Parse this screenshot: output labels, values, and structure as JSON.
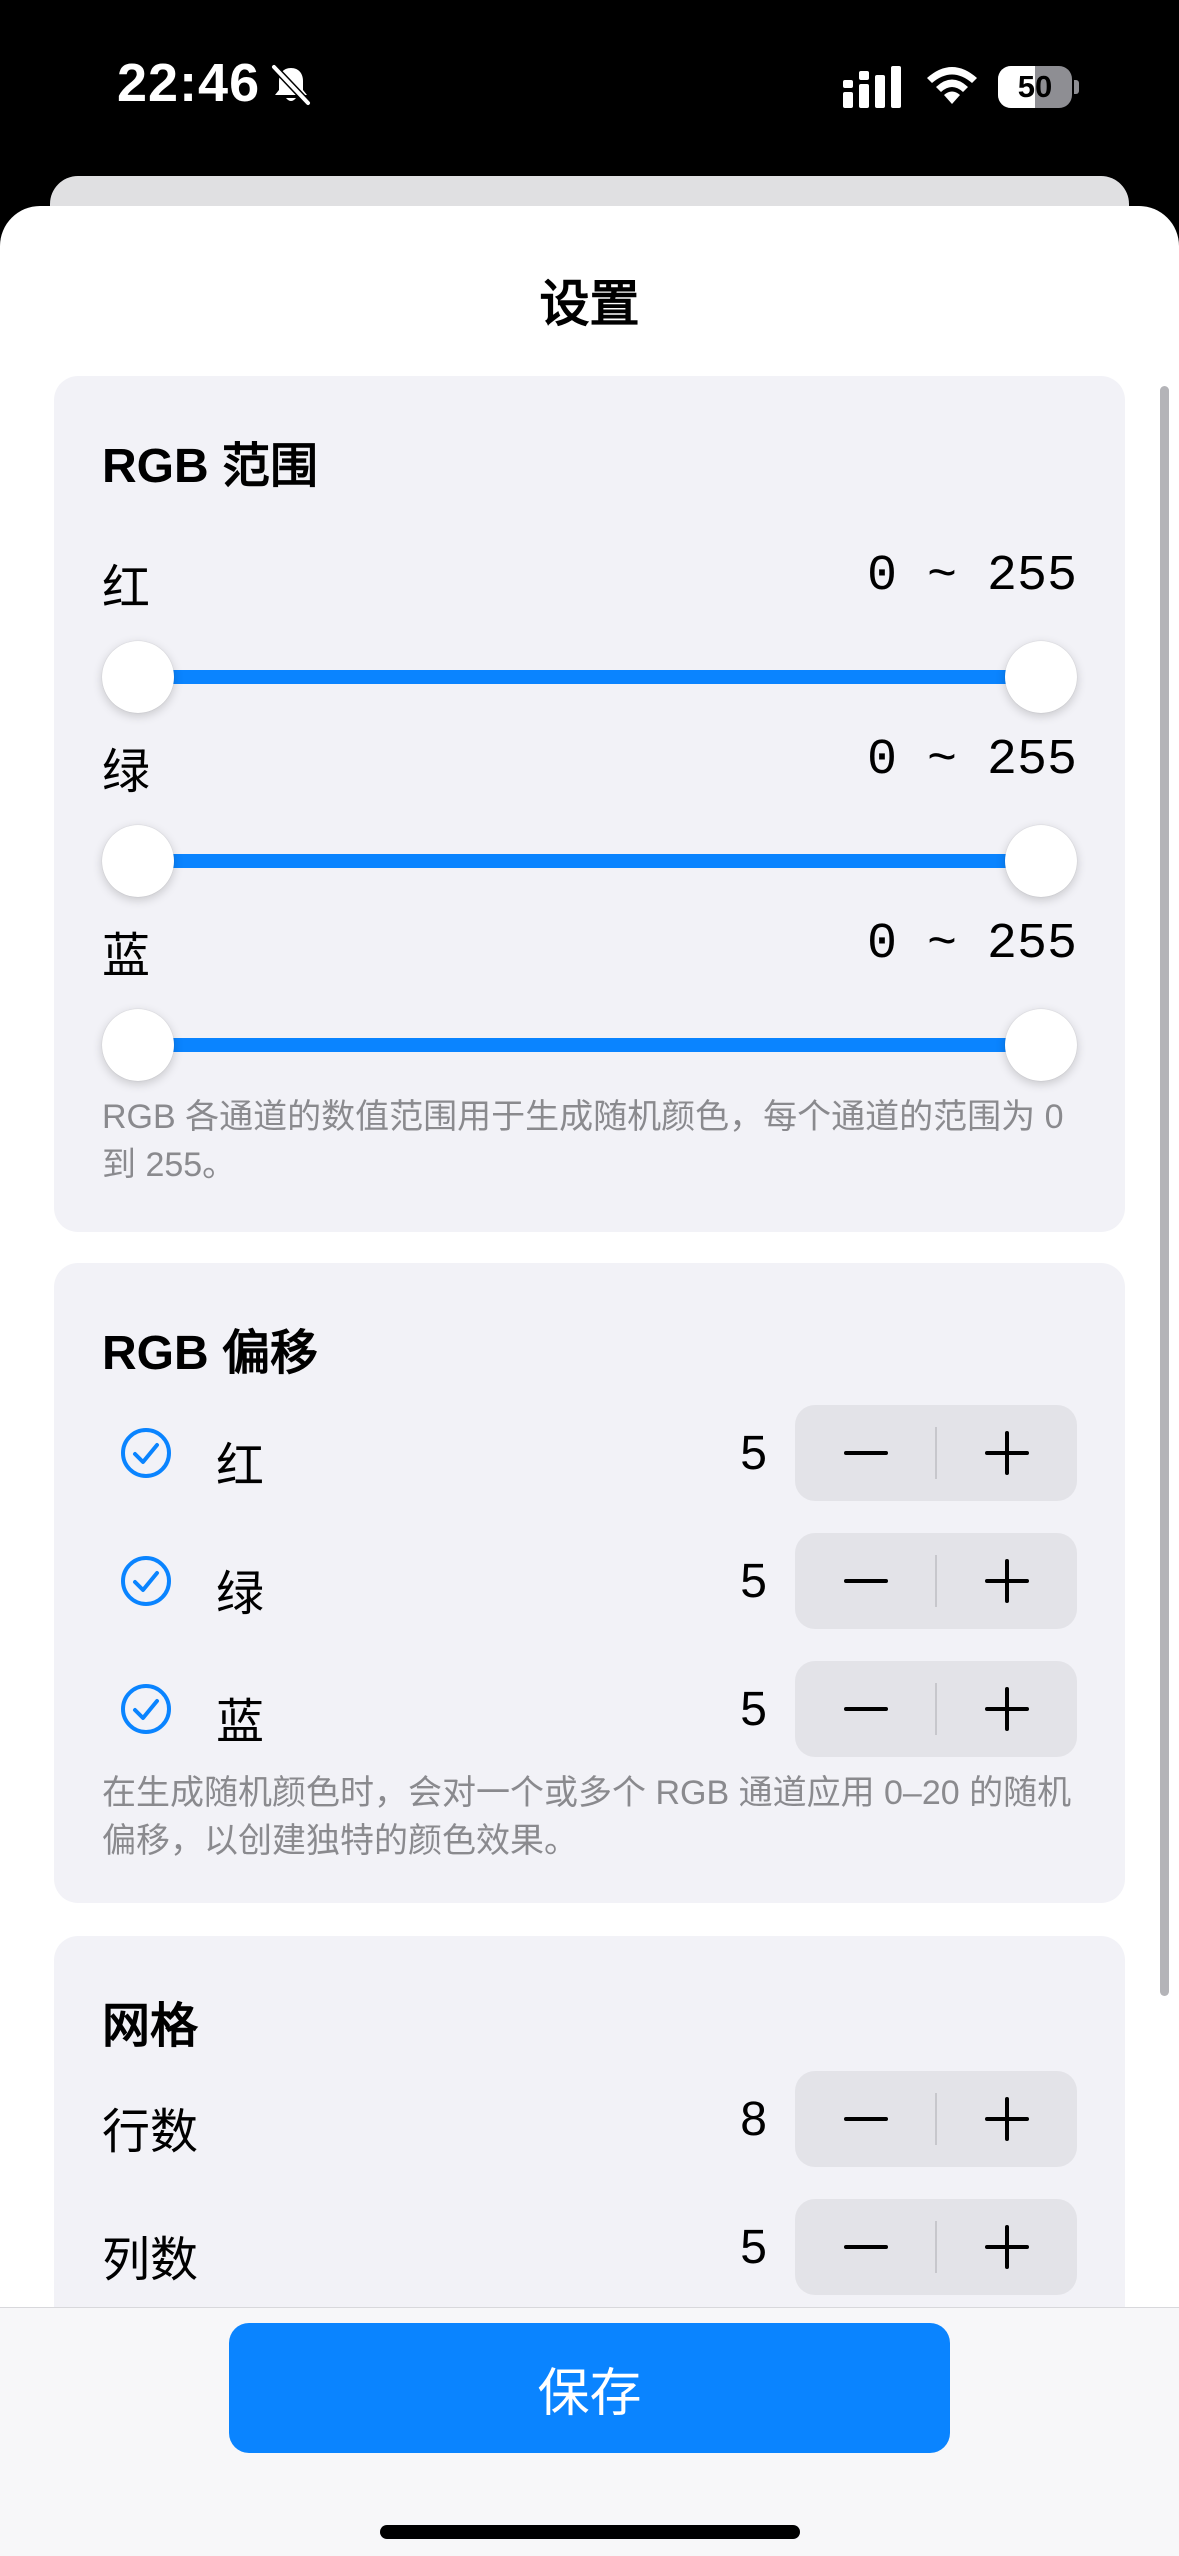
{
  "status_bar": {
    "time": "22:46",
    "battery_level": 50,
    "battery_label": "50"
  },
  "sheet": {
    "title": "设置"
  },
  "rgb_range": {
    "title": "RGB 范围",
    "channels": [
      {
        "label": "红",
        "range_text": "0 ~ 255",
        "min": 0,
        "max": 255
      },
      {
        "label": "绿",
        "range_text": "0 ~ 255",
        "min": 0,
        "max": 255
      },
      {
        "label": "蓝",
        "range_text": "0 ~ 255",
        "min": 0,
        "max": 255
      }
    ],
    "footnote": "RGB 各通道的数值范围用于生成随机颜色，每个通道的范围为 0 到 255。"
  },
  "rgb_offset": {
    "title": "RGB 偏移",
    "channels": [
      {
        "label": "红",
        "checked": true,
        "value": "5"
      },
      {
        "label": "绿",
        "checked": true,
        "value": "5"
      },
      {
        "label": "蓝",
        "checked": true,
        "value": "5"
      }
    ],
    "footnote": "在生成随机颜色时，会对一个或多个 RGB 通道应用 0–20 的随机偏移，以创建独特的颜色效果。"
  },
  "grid": {
    "title": "网格",
    "rows": [
      {
        "label": "行数",
        "value": "8"
      },
      {
        "label": "列数",
        "value": "5"
      }
    ]
  },
  "footer": {
    "save_label": "保存"
  },
  "colors": {
    "accent": "#0a84ff",
    "card": "#f2f2f7",
    "stepper": "#e3e3e8"
  },
  "icons": {
    "check": "checkmark-circle-icon",
    "minus": "minus-icon",
    "plus": "plus-icon",
    "bell": "bell-slash-icon",
    "signal": "cellular-signal-icon",
    "wifi": "wifi-icon"
  }
}
